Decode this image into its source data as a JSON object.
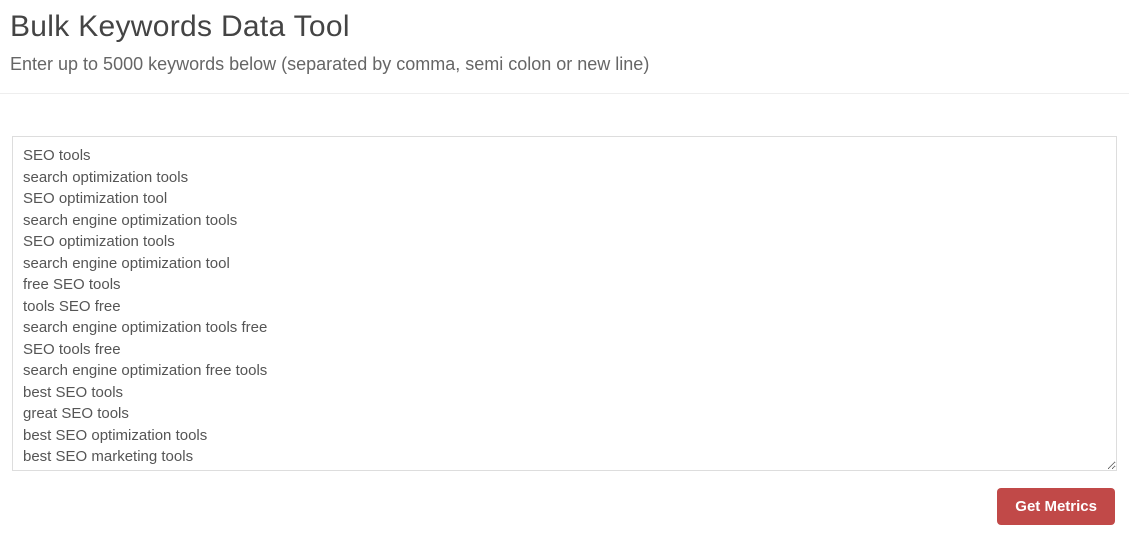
{
  "header": {
    "title": "Bulk Keywords Data Tool",
    "subtitle": "Enter up to 5000 keywords below (separated by comma, semi colon or new line)"
  },
  "form": {
    "keywords_value": "SEO tools\nsearch optimization tools\nSEO optimization tool\nsearch engine optimization tools\nSEO optimization tools\nsearch engine optimization tool\nfree SEO tools\ntools SEO free\nsearch engine optimization tools free\nSEO tools free\nsearch engine optimization free tools\nbest SEO tools\ngreat SEO tools\nbest SEO optimization tools\nbest SEO marketing tools",
    "submit_label": "Get Metrics"
  }
}
